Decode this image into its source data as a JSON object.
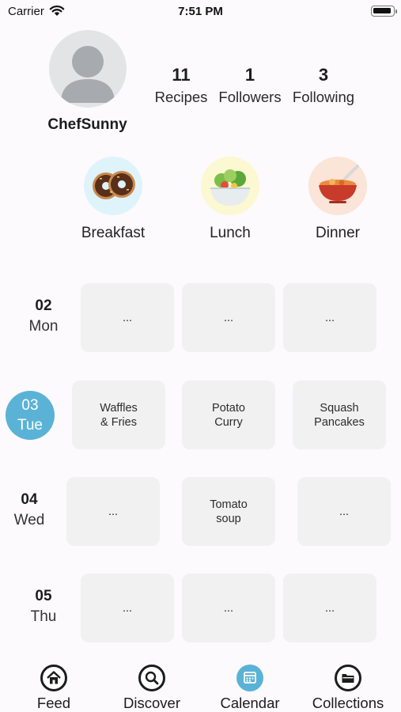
{
  "status_bar": {
    "carrier": "Carrier",
    "time": "7:51 PM"
  },
  "profile": {
    "username": "ChefSunny",
    "stats": [
      {
        "count": "11",
        "label": "Recipes"
      },
      {
        "count": "1",
        "label": "Followers"
      },
      {
        "count": "3",
        "label": "Following"
      }
    ]
  },
  "meal_types": [
    {
      "label": "Breakfast",
      "icon": "donuts-icon"
    },
    {
      "label": "Lunch",
      "icon": "salad-icon"
    },
    {
      "label": "Dinner",
      "icon": "curry-bowl-icon"
    }
  ],
  "calendar": {
    "selected_color": "#5ab3d6",
    "days": [
      {
        "num": "02",
        "name": "Mon",
        "meals": [
          "...",
          "...",
          "..."
        ]
      },
      {
        "num": "03",
        "name": "Tue",
        "meals": [
          "Waffles\n& Fries",
          "Potato\nCurry",
          "Squash\nPancakes"
        ]
      },
      {
        "num": "04",
        "name": "Wed",
        "meals": [
          "...",
          "Tomato\nsoup",
          "..."
        ]
      },
      {
        "num": "05",
        "name": "Thu",
        "meals": [
          "...",
          "...",
          "..."
        ]
      }
    ]
  },
  "tab_bar": {
    "active": "Calendar",
    "tabs": [
      {
        "label": "Feed",
        "icon": "home-icon"
      },
      {
        "label": "Discover",
        "icon": "magnifier-icon"
      },
      {
        "label": "Calendar",
        "icon": "calendar-icon"
      },
      {
        "label": "Collections",
        "icon": "folder-icon"
      }
    ]
  }
}
